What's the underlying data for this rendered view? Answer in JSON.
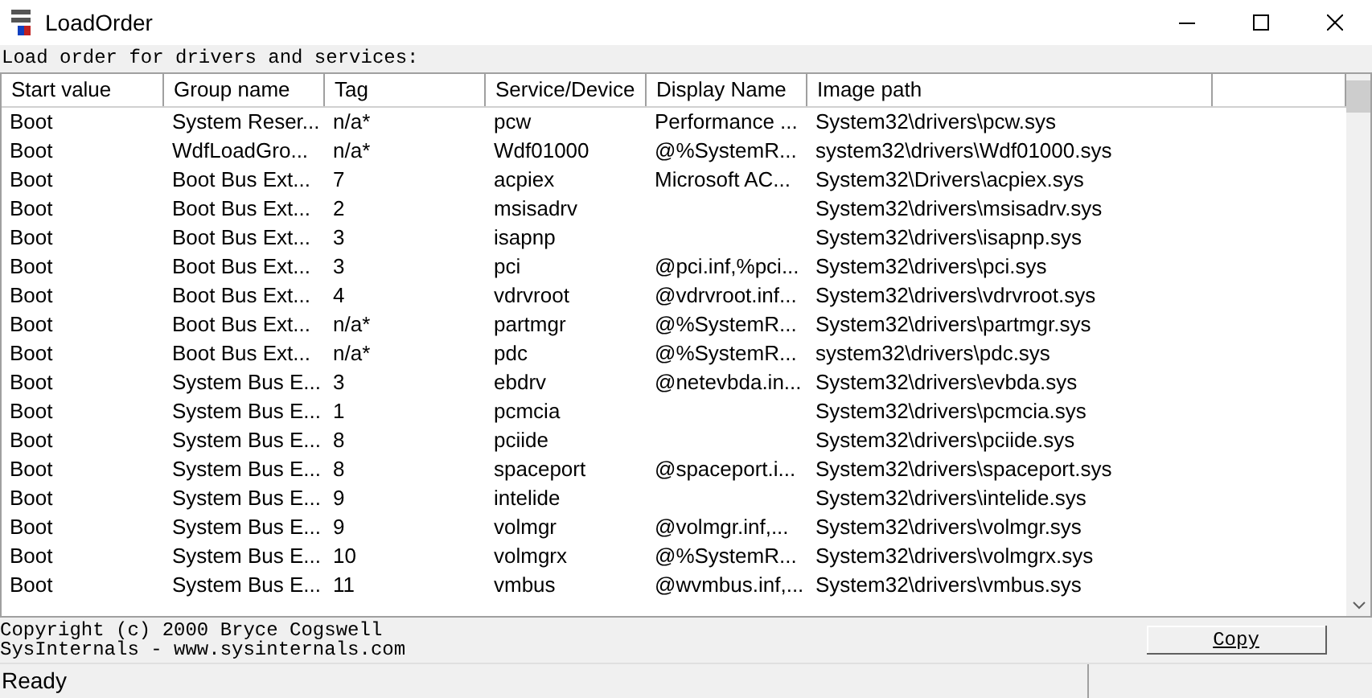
{
  "window": {
    "title": "LoadOrder"
  },
  "caption": "Load order for drivers and services:",
  "table": {
    "columns": [
      "Start value",
      "Group name",
      "Tag",
      "Service/Device",
      "Display Name",
      "Image path"
    ],
    "rows": [
      [
        "Boot",
        "System Reser...",
        "n/a*",
        "pcw",
        "Performance ...",
        "System32\\drivers\\pcw.sys"
      ],
      [
        "Boot",
        "WdfLoadGro...",
        "n/a*",
        "Wdf01000",
        "@%SystemR...",
        "system32\\drivers\\Wdf01000.sys"
      ],
      [
        "Boot",
        "Boot Bus Ext...",
        "7",
        "acpiex",
        "Microsoft AC...",
        "System32\\Drivers\\acpiex.sys"
      ],
      [
        "Boot",
        "Boot Bus Ext...",
        "2",
        "msisadrv",
        "",
        "System32\\drivers\\msisadrv.sys"
      ],
      [
        "Boot",
        "Boot Bus Ext...",
        "3",
        "isapnp",
        "",
        "System32\\drivers\\isapnp.sys"
      ],
      [
        "Boot",
        "Boot Bus Ext...",
        "3",
        "pci",
        "@pci.inf,%pci...",
        "System32\\drivers\\pci.sys"
      ],
      [
        "Boot",
        "Boot Bus Ext...",
        "4",
        "vdrvroot",
        "@vdrvroot.inf...",
        "System32\\drivers\\vdrvroot.sys"
      ],
      [
        "Boot",
        "Boot Bus Ext...",
        "n/a*",
        "partmgr",
        "@%SystemR...",
        "System32\\drivers\\partmgr.sys"
      ],
      [
        "Boot",
        "Boot Bus Ext...",
        "n/a*",
        "pdc",
        "@%SystemR...",
        "system32\\drivers\\pdc.sys"
      ],
      [
        "Boot",
        "System Bus E...",
        "3",
        "ebdrv",
        "@netevbda.in...",
        "System32\\drivers\\evbda.sys"
      ],
      [
        "Boot",
        "System Bus E...",
        "1",
        "pcmcia",
        "",
        "System32\\drivers\\pcmcia.sys"
      ],
      [
        "Boot",
        "System Bus E...",
        "8",
        "pciide",
        "",
        "System32\\drivers\\pciide.sys"
      ],
      [
        "Boot",
        "System Bus E...",
        "8",
        "spaceport",
        "@spaceport.i...",
        "System32\\drivers\\spaceport.sys"
      ],
      [
        "Boot",
        "System Bus E...",
        "9",
        "intelide",
        "",
        "System32\\drivers\\intelide.sys"
      ],
      [
        "Boot",
        "System Bus E...",
        "9",
        "volmgr",
        "@volmgr.inf,...",
        "System32\\drivers\\volmgr.sys"
      ],
      [
        "Boot",
        "System Bus E...",
        "10",
        "volmgrx",
        "@%SystemR...",
        "System32\\drivers\\volmgrx.sys"
      ],
      [
        "Boot",
        "System Bus E...",
        "11",
        "vmbus",
        "@wvmbus.inf,...",
        "System32\\drivers\\vmbus.sys"
      ]
    ]
  },
  "footer": {
    "lines": [
      "Copyright (c) 2000 Bryce Cogswell",
      "SysInternals - www.sysinternals.com"
    ],
    "button": "Copy"
  },
  "status_bar": "Ready"
}
